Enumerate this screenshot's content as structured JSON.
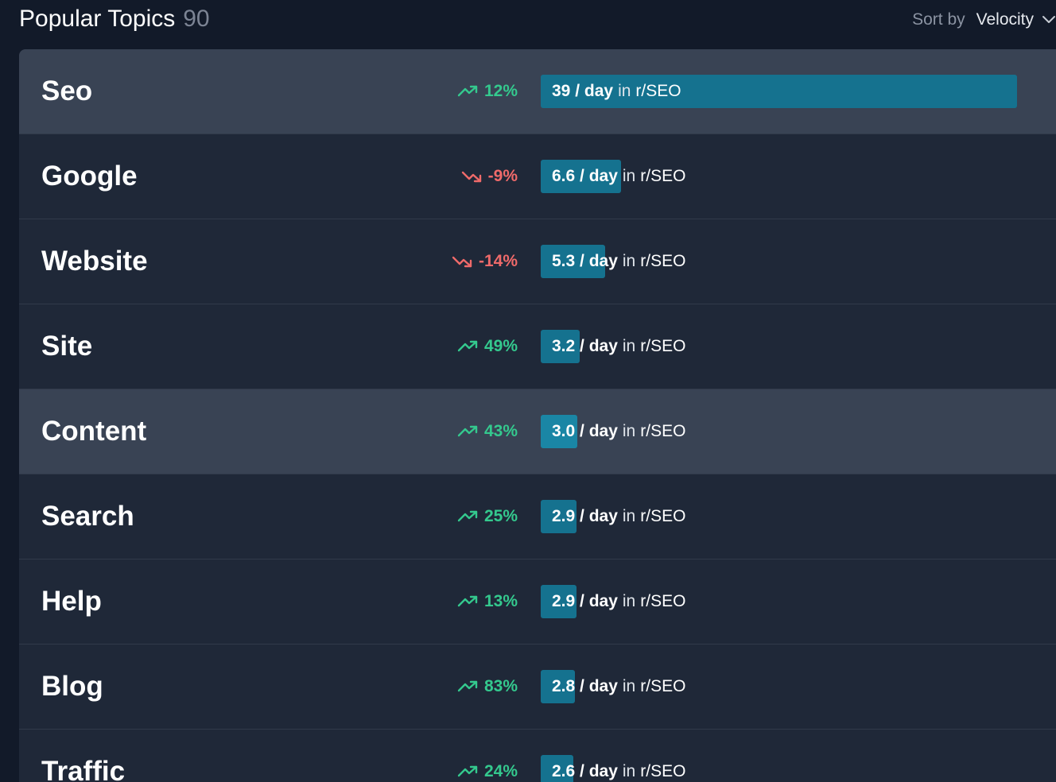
{
  "header": {
    "title": "Popular Topics",
    "count": "90",
    "sort_label": "Sort by",
    "sort_value": "Velocity"
  },
  "colors": {
    "background": "#121a29",
    "row": "#1f2838",
    "row_highlight": "#394354",
    "bar": "#15728f",
    "trend_up": "#34c98e",
    "trend_down": "#ef6a6a"
  },
  "bar_max_rate": 39,
  "rows": [
    {
      "topic": "Seo",
      "trend": "12%",
      "direction": "up",
      "rate": "39 / day",
      "rate_value": 39,
      "in": "in",
      "subreddit": "r/SEO",
      "highlighted": true
    },
    {
      "topic": "Google",
      "trend": "-9%",
      "direction": "down",
      "rate": "6.6 / day",
      "rate_value": 6.6,
      "in": "in",
      "subreddit": "r/SEO",
      "highlighted": false
    },
    {
      "topic": "Website",
      "trend": "-14%",
      "direction": "down",
      "rate": "5.3 / day",
      "rate_value": 5.3,
      "in": "in",
      "subreddit": "r/SEO",
      "highlighted": false
    },
    {
      "topic": "Site",
      "trend": "49%",
      "direction": "up",
      "rate": "3.2 / day",
      "rate_value": 3.2,
      "in": "in",
      "subreddit": "r/SEO",
      "highlighted": false
    },
    {
      "topic": "Content",
      "trend": "43%",
      "direction": "up",
      "rate": "3.0 / day",
      "rate_value": 3.0,
      "in": "in",
      "subreddit": "r/SEO",
      "highlighted": true
    },
    {
      "topic": "Search",
      "trend": "25%",
      "direction": "up",
      "rate": "2.9 / day",
      "rate_value": 2.9,
      "in": "in",
      "subreddit": "r/SEO",
      "highlighted": false
    },
    {
      "topic": "Help",
      "trend": "13%",
      "direction": "up",
      "rate": "2.9 / day",
      "rate_value": 2.9,
      "in": "in",
      "subreddit": "r/SEO",
      "highlighted": false
    },
    {
      "topic": "Blog",
      "trend": "83%",
      "direction": "up",
      "rate": "2.8 / day",
      "rate_value": 2.8,
      "in": "in",
      "subreddit": "r/SEO",
      "highlighted": false
    },
    {
      "topic": "Traffic",
      "trend": "24%",
      "direction": "up",
      "rate": "2.6 / day",
      "rate_value": 2.6,
      "in": "in",
      "subreddit": "r/SEO",
      "highlighted": false
    }
  ]
}
